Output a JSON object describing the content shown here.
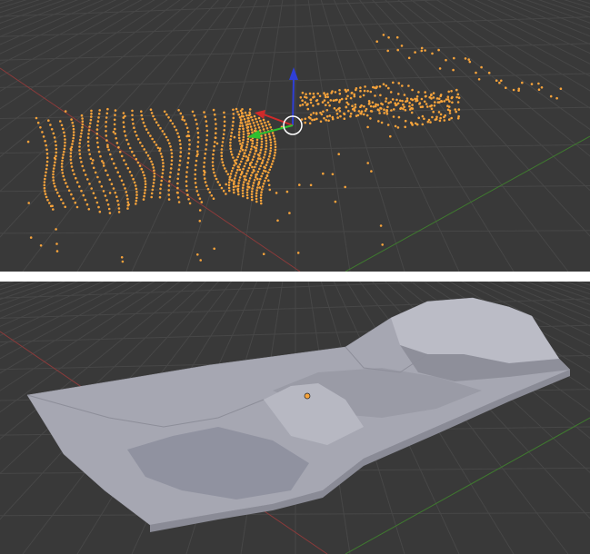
{
  "colors": {
    "background": "#393939",
    "grid": "#474747",
    "x_axis": "#8a3a3a",
    "y_axis": "#3f7a2f",
    "selected_points": "#f6a33b",
    "mesh_surface": "#a7a8b3",
    "divider": "#ffffff"
  },
  "top_view": {
    "mode": "point-cloud-selected",
    "gizmo": "translate-manipulator"
  },
  "bottom_view": {
    "mode": "mesh-surface",
    "origin_marker": "object-origin"
  }
}
